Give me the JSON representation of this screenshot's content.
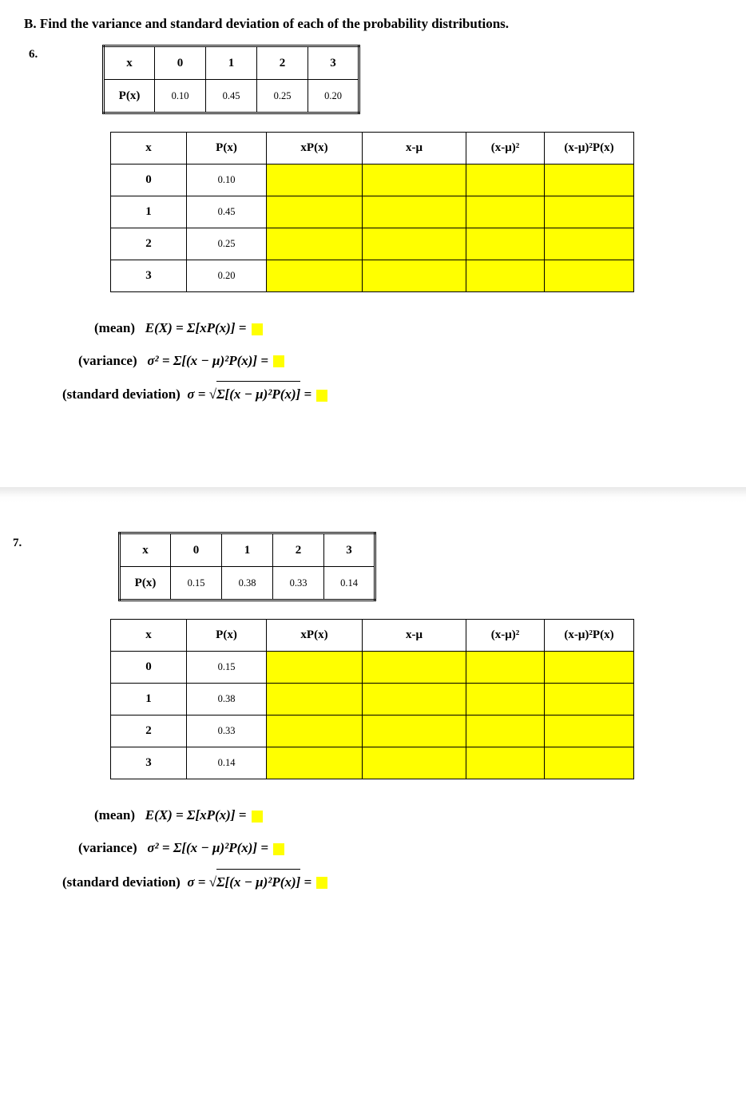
{
  "heading": "B. Find the variance and standard deviation of each of the probability distributions.",
  "problems": [
    {
      "number": "6.",
      "dist": {
        "x_label": "x",
        "p_label": "P(x)",
        "xs": [
          "0",
          "1",
          "2",
          "3"
        ],
        "ps": [
          "0.10",
          "0.45",
          "0.25",
          "0.20"
        ]
      },
      "work": {
        "headers": [
          "x",
          "P(x)",
          "xP(x)",
          "x-μ",
          "(x-μ)²",
          "(x-μ)²P(x)"
        ],
        "rows": [
          {
            "x": "0",
            "px": "0.10"
          },
          {
            "x": "1",
            "px": "0.45"
          },
          {
            "x": "2",
            "px": "0.25"
          },
          {
            "x": "3",
            "px": "0.20"
          }
        ]
      },
      "formulas": {
        "mean_label": "(mean)",
        "mean_expr": "E(X) = Σ[xP(x)] =",
        "var_label": "(variance)",
        "var_expr": "σ² = Σ[(x − μ)²P(x)] =",
        "sd_label": "(standard deviation)",
        "sd_prefix": "σ = ",
        "sd_radicand": "Σ[(x − μ)²P(x)]",
        "sd_eq": " ="
      }
    },
    {
      "number": "7.",
      "dist": {
        "x_label": "x",
        "p_label": "P(x)",
        "xs": [
          "0",
          "1",
          "2",
          "3"
        ],
        "ps": [
          "0.15",
          "0.38",
          "0.33",
          "0.14"
        ]
      },
      "work": {
        "headers": [
          "x",
          "P(x)",
          "xP(x)",
          "x-μ",
          "(x-μ)²",
          "(x-μ)²P(x)"
        ],
        "rows": [
          {
            "x": "0",
            "px": "0.15"
          },
          {
            "x": "1",
            "px": "0.38"
          },
          {
            "x": "2",
            "px": "0.33"
          },
          {
            "x": "3",
            "px": "0.14"
          }
        ]
      },
      "formulas": {
        "mean_label": "(mean)",
        "mean_expr": "E(X) = Σ[xP(x)] =",
        "var_label": "(variance)",
        "var_expr": "σ² = Σ[(x − μ)²P(x)] =",
        "sd_label": "(standard deviation)",
        "sd_prefix": "σ = ",
        "sd_radicand": "Σ[(x − μ)²P(x)]",
        "sd_eq": " ="
      }
    }
  ]
}
